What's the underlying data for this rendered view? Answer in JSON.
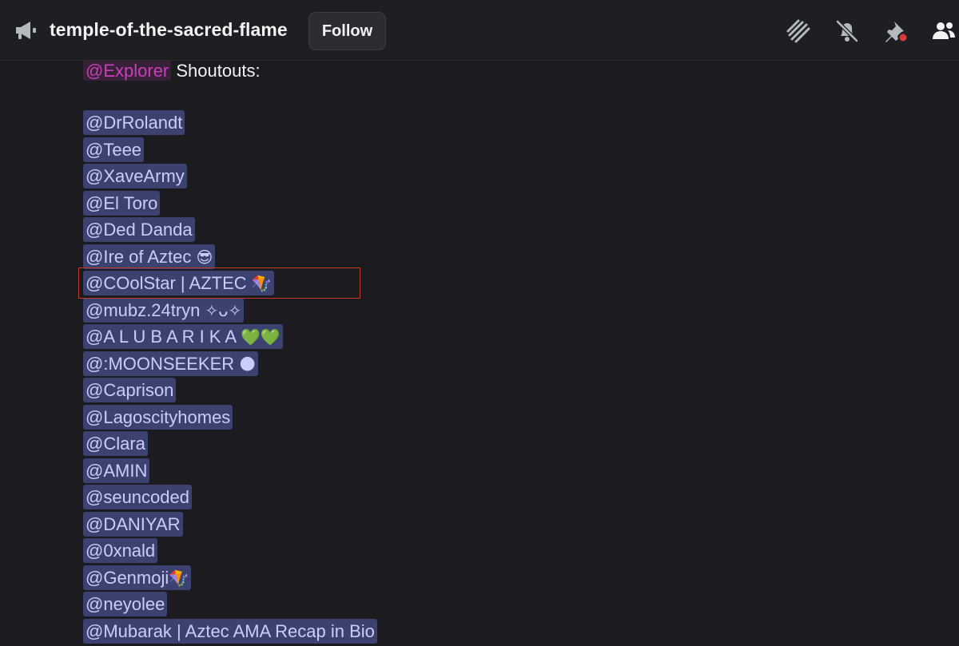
{
  "header": {
    "channel_icon": "megaphone-icon",
    "channel_name": "temple-of-the-sacred-flame",
    "follow_label": "Follow",
    "icons": [
      "threads-icon",
      "mute-bell-icon",
      "pin-icon",
      "members-icon"
    ],
    "pin_notification_color": "#da373c"
  },
  "message": {
    "role_mention": "@Explorer",
    "intro_text": " Shoutouts:",
    "mentions": [
      {
        "text": "@DrRolandt",
        "emoji": ""
      },
      {
        "text": "@Teee",
        "emoji": ""
      },
      {
        "text": "@XaveArmy",
        "emoji": ""
      },
      {
        "text": "@El Toro",
        "emoji": ""
      },
      {
        "text": "@Ded Danda",
        "emoji": ""
      },
      {
        "text": "@Ire of Aztec ",
        "emoji": "😎"
      },
      {
        "text": "@COolStar | AZTEC ",
        "emoji": "🪁"
      },
      {
        "text": "@mubz.24tryn ",
        "emoji": "✧ᴗ✧"
      },
      {
        "text": "@A L U B A R I K A ",
        "emoji": "💚💚"
      },
      {
        "text": "@:MOONSEEKER ",
        "emoji": "🌑"
      },
      {
        "text": "@Caprison",
        "emoji": ""
      },
      {
        "text": "@Lagoscityhomes",
        "emoji": ""
      },
      {
        "text": "@Clara",
        "emoji": ""
      },
      {
        "text": "@AMIN",
        "emoji": ""
      },
      {
        "text": "@seuncoded",
        "emoji": ""
      },
      {
        "text": "@DANIYAR",
        "emoji": ""
      },
      {
        "text": "@0xnald",
        "emoji": ""
      },
      {
        "text": "@Genmoji",
        "emoji": "🪁"
      },
      {
        "text": "@neyolee",
        "emoji": ""
      },
      {
        "text": "@Mubarak | Aztec AMA Recap in Bio",
        "emoji": ""
      }
    ]
  },
  "colors": {
    "background": "#1c1c20",
    "mention_bg": "#3c4270",
    "mention_text": "#c9cdfb",
    "role_mention_text": "#c840b8",
    "highlight_border": "#c0392b"
  }
}
